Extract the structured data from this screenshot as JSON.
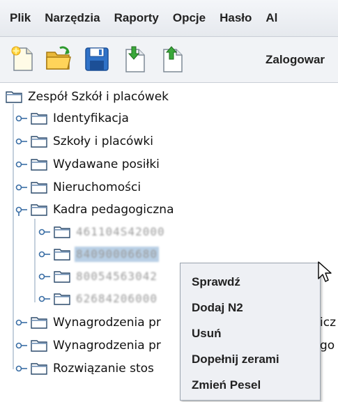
{
  "menubar": {
    "items": [
      "Plik",
      "Narzędzia",
      "Raporty",
      "Opcje",
      "Hasło",
      "Al"
    ]
  },
  "toolbar": {
    "buttons": [
      "new-document-icon",
      "open-folder-icon",
      "save-icon",
      "import-icon",
      "export-icon"
    ],
    "status_text": "Zalogowar"
  },
  "tree": {
    "root": "Zespół Szkół i placówek",
    "items": [
      "Identyfikacja",
      "Szkoły i placówki",
      "Wydawane posiłki",
      "Nieruchomości",
      "Kadra pedagogiczna",
      "Wynagrodzenia pr",
      "Wynagrodzenia pr",
      "Rozwiązanie stos"
    ],
    "kadra_children": [
      "461104S42000",
      "84090006680",
      "80054563042",
      "62684206000"
    ],
    "overflow_fragments": [
      "icz",
      "go"
    ]
  },
  "context_menu": {
    "items": [
      "Sprawdź",
      "Dodaj N2",
      "Usuń",
      "Dopełnij zerami",
      "Zmień Pesel"
    ]
  },
  "colors": {
    "selection": "#b8cfe5",
    "menu_bg": "#eef0f4"
  }
}
